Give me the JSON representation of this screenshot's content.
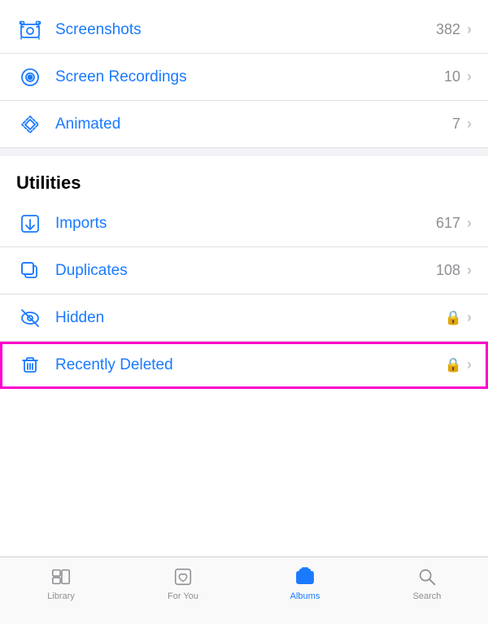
{
  "items_top": [
    {
      "id": "screenshots",
      "label": "Screenshots",
      "count": "382",
      "icon": "screenshot",
      "lock": false
    },
    {
      "id": "screen-recordings",
      "label": "Screen Recordings",
      "count": "10",
      "icon": "screen-recording",
      "lock": false
    },
    {
      "id": "animated",
      "label": "Animated",
      "count": "7",
      "icon": "animated",
      "lock": false
    }
  ],
  "section_utilities": {
    "header": "Utilities",
    "items": [
      {
        "id": "imports",
        "label": "Imports",
        "count": "617",
        "icon": "imports",
        "lock": false
      },
      {
        "id": "duplicates",
        "label": "Duplicates",
        "count": "108",
        "icon": "duplicates",
        "lock": false
      },
      {
        "id": "hidden",
        "label": "Hidden",
        "count": "",
        "icon": "hidden",
        "lock": true
      },
      {
        "id": "recently-deleted",
        "label": "Recently Deleted",
        "count": "",
        "icon": "recently-deleted",
        "lock": true,
        "highlighted": true
      }
    ]
  },
  "tabs": [
    {
      "id": "library",
      "label": "Library",
      "active": false
    },
    {
      "id": "for-you",
      "label": "For You",
      "active": false
    },
    {
      "id": "albums",
      "label": "Albums",
      "active": true
    },
    {
      "id": "search",
      "label": "Search",
      "active": false
    }
  ],
  "colors": {
    "blue": "#1a7aff",
    "gray": "#8e8e93",
    "highlight": "#ff00cc"
  }
}
